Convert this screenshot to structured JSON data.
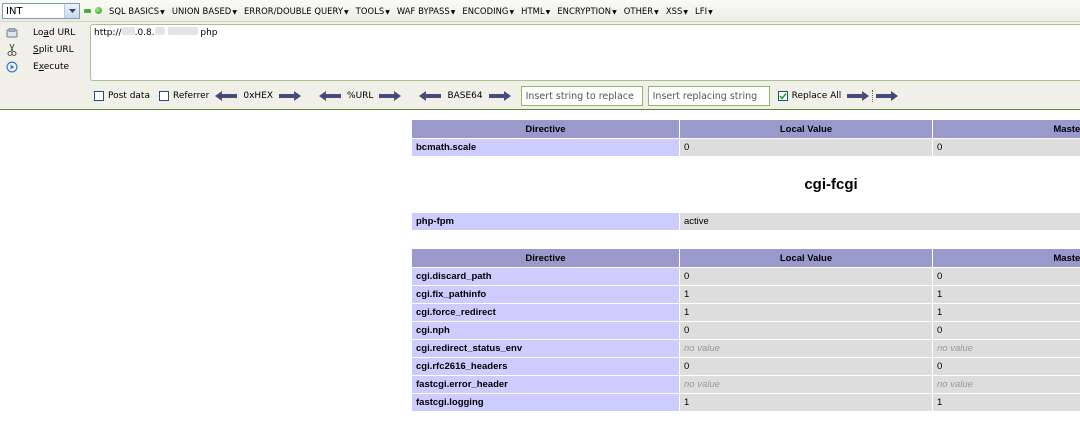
{
  "hackbar": {
    "type_select": "INT",
    "menus": [
      "SQL BASICS",
      "UNION BASED",
      "ERROR/DOUBLE QUERY",
      "TOOLS",
      "WAF BYPASS",
      "ENCODING",
      "HTML",
      "ENCRYPTION",
      "OTHER",
      "XSS",
      "LFI"
    ],
    "actions": {
      "load": {
        "pre": "Lo",
        "key": "a",
        "post": "d URL"
      },
      "split": {
        "pre": "",
        "key": "S",
        "post": "plit URL"
      },
      "execute": {
        "pre": "E",
        "key": "x",
        "post": "ecute"
      }
    },
    "url": {
      "prefix": "http://",
      "mid": ".0.8.",
      "suffix": "php"
    },
    "options": {
      "post_data": "Post data",
      "referrer": "Referrer",
      "hex": "0xHEX",
      "url_enc": "%URL",
      "base64": "BASE64",
      "replace_placeholder": "Insert string to replace",
      "replacing_placeholder": "Insert replacing string",
      "replace_all": "Replace All"
    },
    "colors": {
      "accent": "#5c8a34",
      "arrow": "#4a4a7a"
    }
  },
  "table1": {
    "headers": [
      "Directive",
      "Local Value",
      "Master"
    ],
    "rows": [
      {
        "name": "bcmath.scale",
        "local": "0",
        "master": "0"
      }
    ]
  },
  "section_title": "cgi-fcgi",
  "table2": {
    "rows": [
      {
        "name": "php-fpm",
        "value": "active"
      }
    ]
  },
  "table3": {
    "headers": [
      "Directive",
      "Local Value",
      "Master"
    ],
    "rows": [
      {
        "name": "cgi.discard_path",
        "local": "0",
        "master": "0"
      },
      {
        "name": "cgi.fix_pathinfo",
        "local": "1",
        "master": "1"
      },
      {
        "name": "cgi.force_redirect",
        "local": "1",
        "master": "1"
      },
      {
        "name": "cgi.nph",
        "local": "0",
        "master": "0"
      },
      {
        "name": "cgi.redirect_status_env",
        "local": "no value",
        "master": "no value"
      },
      {
        "name": "cgi.rfc2616_headers",
        "local": "0",
        "master": "0"
      },
      {
        "name": "fastcgi.error_header",
        "local": "no value",
        "master": "no value"
      },
      {
        "name": "fastcgi.logging",
        "local": "1",
        "master": "1"
      }
    ]
  }
}
